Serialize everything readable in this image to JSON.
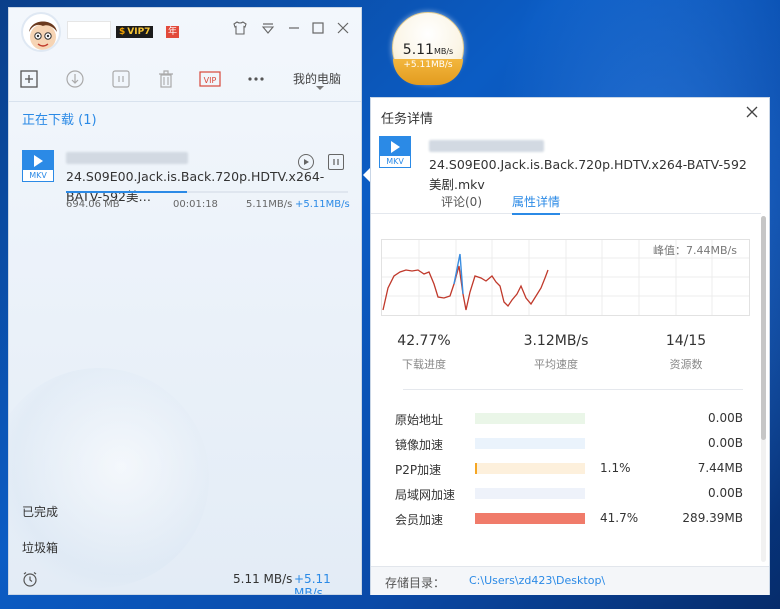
{
  "floating_ball": {
    "speed": "5.11",
    "speed_unit": "MB/s",
    "boost": "+5.11MB/s"
  },
  "main": {
    "badges": {
      "vip": "VIP7",
      "year": "年"
    },
    "my_pc": "我的电脑",
    "section": "正在下载 (1)",
    "task": {
      "ext": "MKV",
      "name": "24.S09E00.Jack.is.Back.720p.HDTV.x264-BATV-592美…",
      "size": "694.06 MB",
      "time": "00:01:18",
      "speed": "5.11MB/s",
      "boost": "+5.11MB/s",
      "progress": 0.4277
    },
    "sidebar": {
      "completed": "已完成",
      "trash": "垃圾箱"
    },
    "footer": {
      "speed": "5.11 MB/s",
      "boost": "+5.11 MB/s"
    }
  },
  "detail": {
    "title": "任务详情",
    "file_ext": "MKV",
    "file_name": "24.S09E00.Jack.is.Back.720p.HDTV.x264-BATV-592美剧.mkv",
    "tabs": [
      {
        "label": "评论(0)"
      },
      {
        "label": "属性详情"
      }
    ],
    "peak": "峰值：7.44MB/s",
    "stats": [
      {
        "value": "42.77%",
        "label": "下载进度"
      },
      {
        "value": "3.12MB/s",
        "label": "平均速度"
      },
      {
        "value": "14/15",
        "label": "资源数"
      }
    ],
    "sources": [
      {
        "name": "原始地址",
        "pct": "",
        "size": "0.00B",
        "fill": 0,
        "color": "#cfeccc",
        "track": "#eaf6e8"
      },
      {
        "name": "镜像加速",
        "pct": "",
        "size": "0.00B",
        "fill": 0,
        "color": "#cfe2f6",
        "track": "#eaf3fc"
      },
      {
        "name": "P2P加速",
        "pct": "1.1%",
        "size": "7.44MB",
        "fill": 0.011,
        "color": "#f5a623",
        "track": "#fdf0dc"
      },
      {
        "name": "局域网加速",
        "pct": "",
        "size": "0.00B",
        "fill": 0,
        "color": "#dfe6f4",
        "track": "#eef2fa"
      },
      {
        "name": "会员加速",
        "pct": "41.7%",
        "size": "289.39MB",
        "fill": 1,
        "color": "#f07b6a",
        "track": "#fde4e0"
      }
    ],
    "storage_label": "存储目录：",
    "storage_path": "C:\\Users\\zd423\\Desktop\\"
  },
  "colors": {
    "accent": "#2b8ae6",
    "chart_line": "#c0392b",
    "chart_peak": "#3a8de0"
  }
}
